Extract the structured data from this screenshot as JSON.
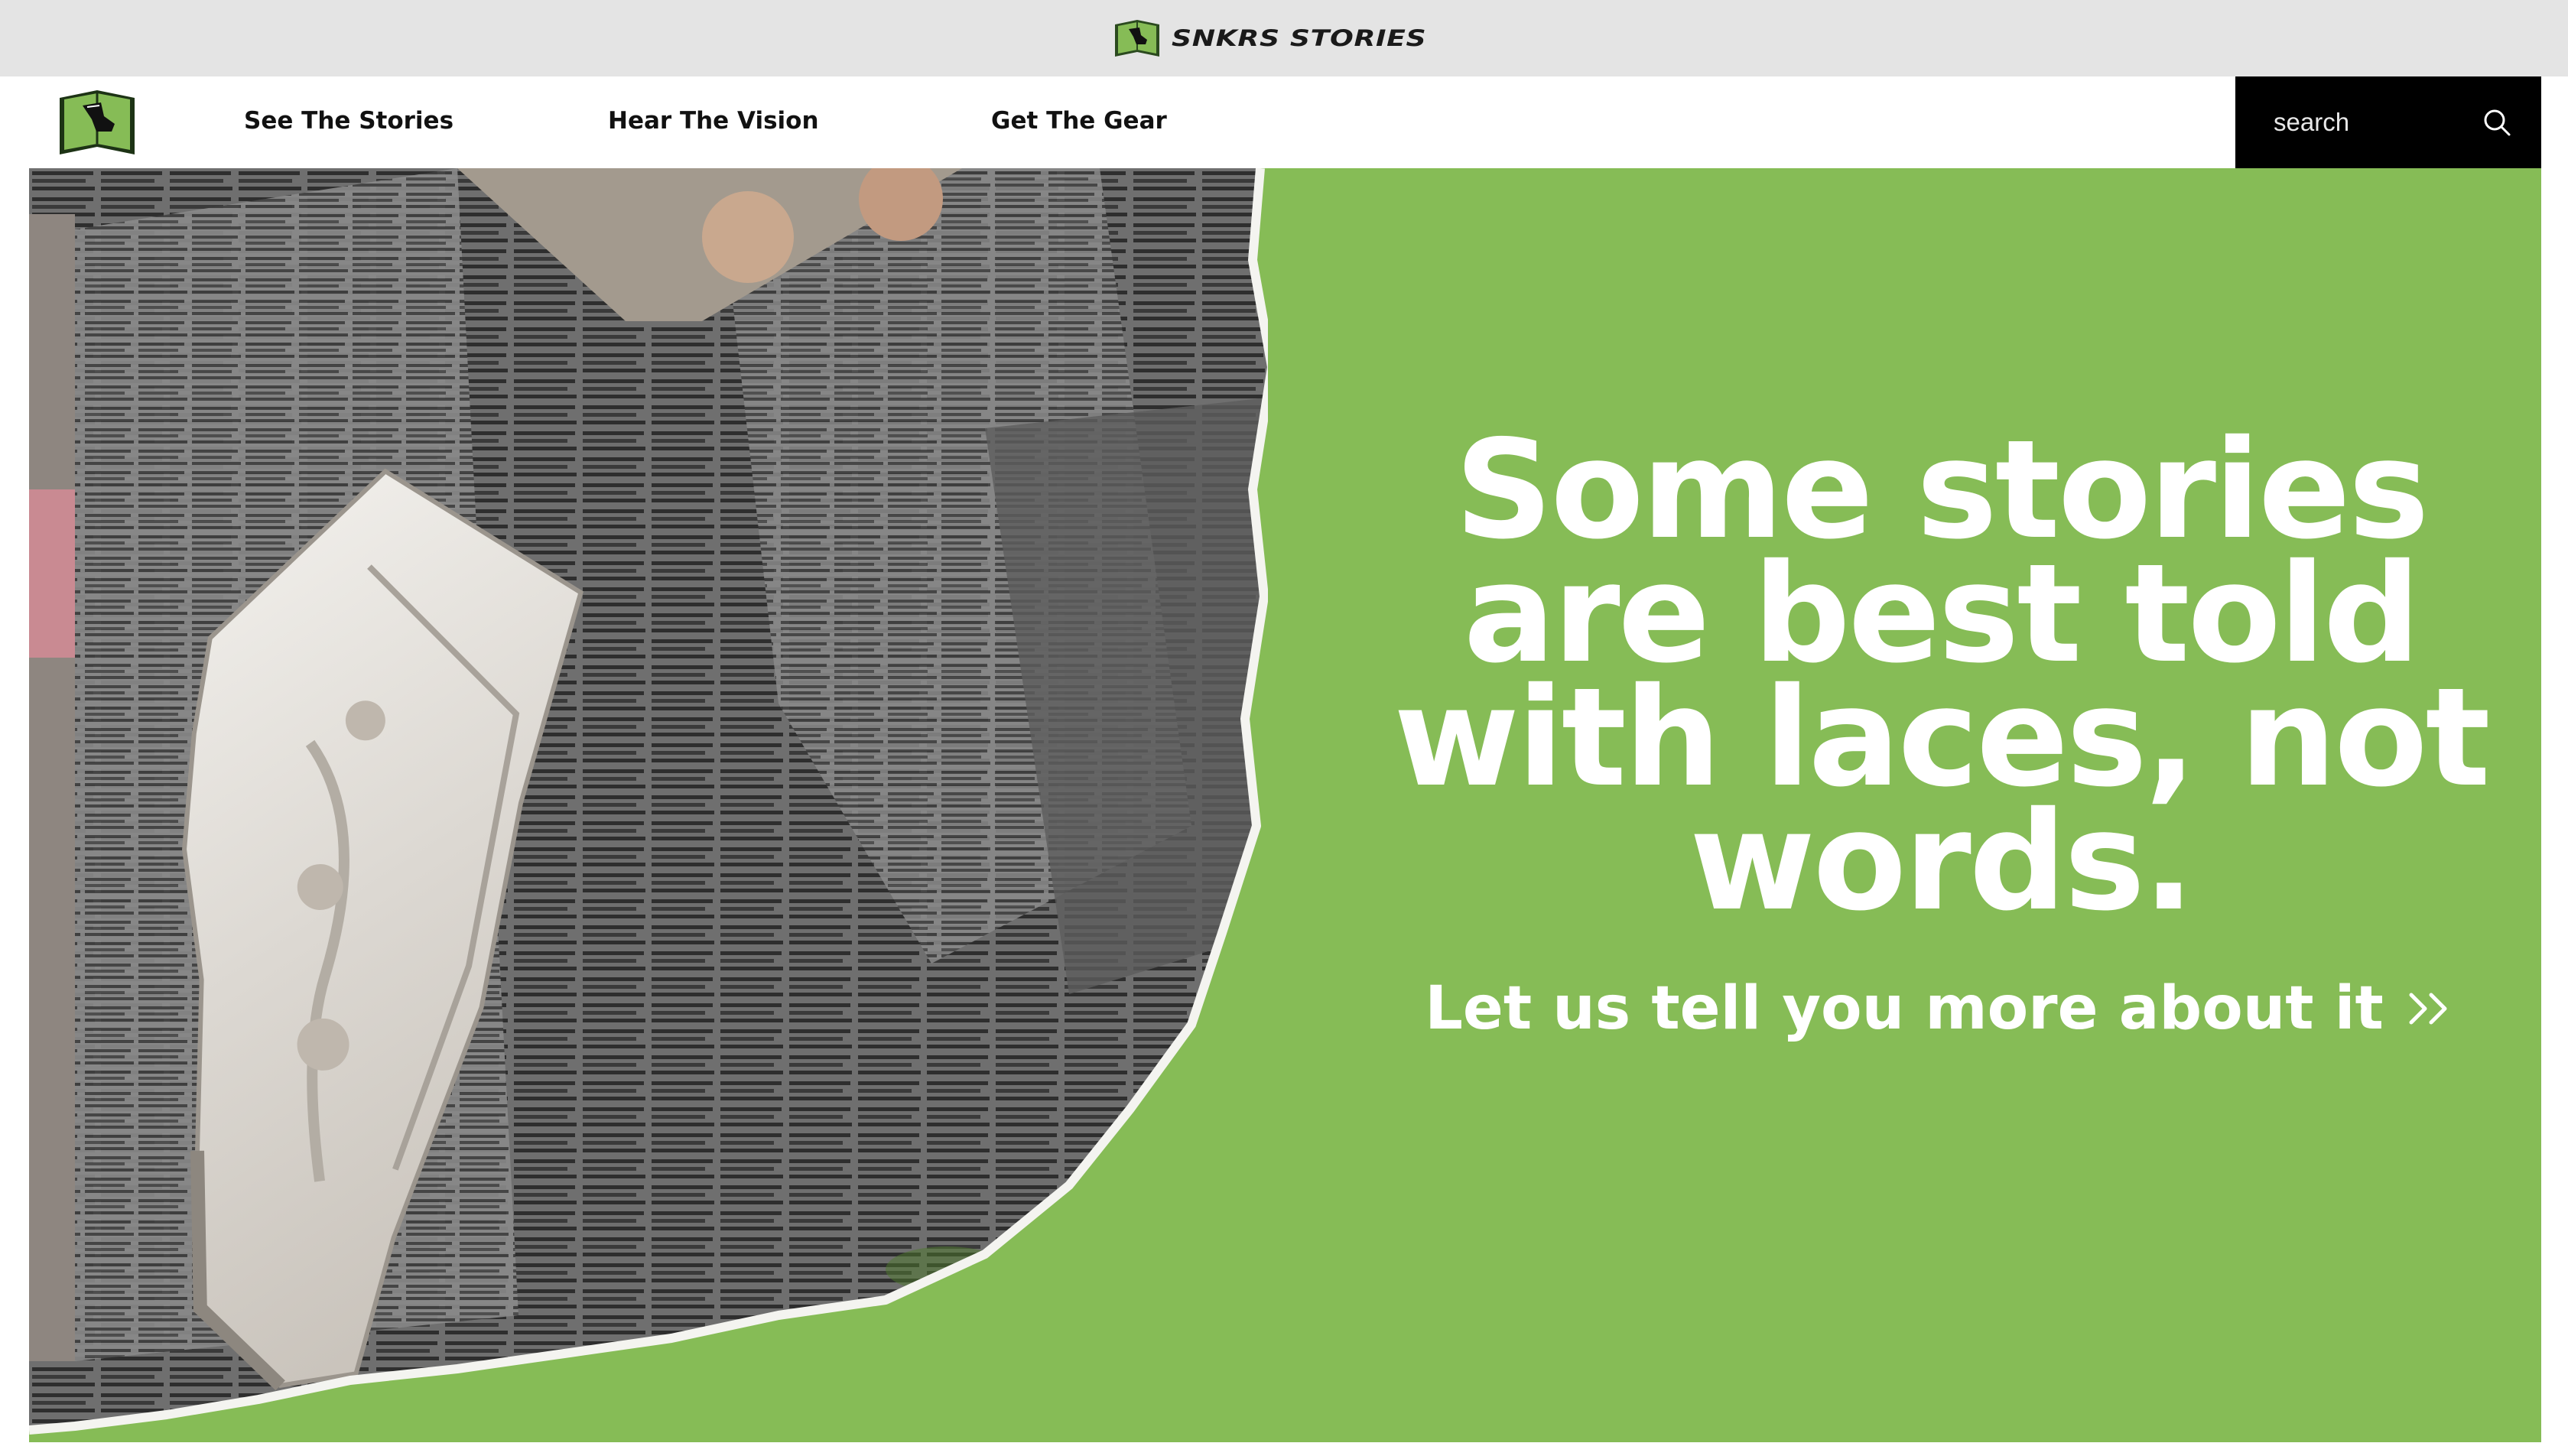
{
  "brand": {
    "wordmark": "SNKRS STORIES",
    "logo_icon": "book-shoe-logo-icon",
    "accent_color": "#86bc56",
    "dark_color": "#111111"
  },
  "nav": {
    "links": [
      {
        "label": "See The Stories"
      },
      {
        "label": "Hear The Vision"
      },
      {
        "label": "Get The Gear"
      }
    ],
    "search": {
      "placeholder": "search",
      "icon": "search-icon"
    }
  },
  "hero": {
    "headline": "Some stories are best told with laces, not words.",
    "cta_label": "Let us tell you more about it",
    "cta_icon": "double-chevron-right-icon",
    "background_color": "#86bc56",
    "image_subject": "collage-sneaker-on-newspaper"
  }
}
